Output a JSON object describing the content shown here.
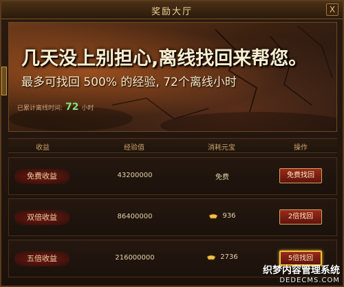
{
  "window": {
    "title": "奖励大厅",
    "close_glyph": "X"
  },
  "banner": {
    "headline": "几天没上别担心,离线找回来帮您。",
    "subline": "最多可找回 500% 的经验, 72个离线小时",
    "accumulated_label": "已累计离线时间:",
    "accumulated_value": "72",
    "accumulated_unit": "小时"
  },
  "table": {
    "headers": [
      "收益",
      "经验值",
      "消耗元宝",
      "操作"
    ],
    "rows": [
      {
        "label": "免费收益",
        "exp": "43200000",
        "cost": "免费",
        "cost_has_gold_icon": false,
        "button": "免费找回",
        "active": false
      },
      {
        "label": "双倍收益",
        "exp": "86400000",
        "cost": "936",
        "cost_has_gold_icon": true,
        "button": "2倍找回",
        "active": false
      },
      {
        "label": "五倍收益",
        "exp": "216000000",
        "cost": "2736",
        "cost_has_gold_icon": true,
        "button": "5倍找回",
        "active": true
      }
    ]
  },
  "watermark": {
    "line1": "织梦内容管理系统",
    "line2": "DEDECMS.COM"
  },
  "colors": {
    "accent_gold": "#f2c23a",
    "button_red": "#9a2a1c",
    "accumulated_green": "#7ee87a"
  }
}
